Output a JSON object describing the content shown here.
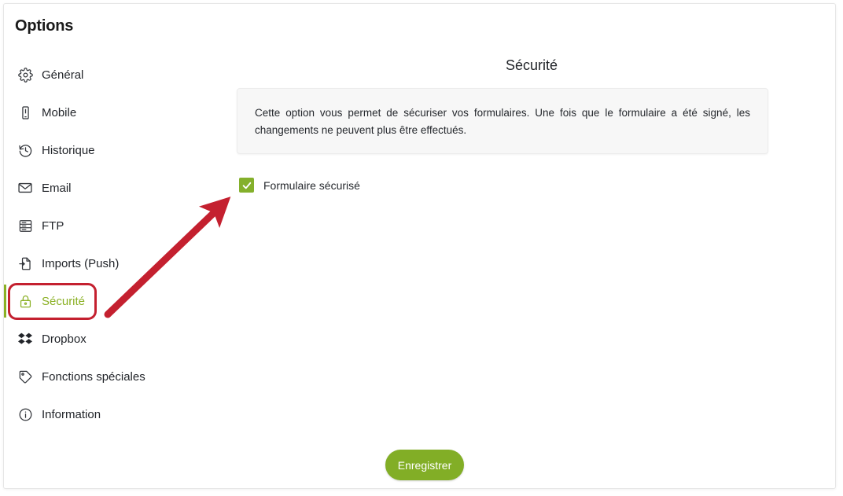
{
  "window": {
    "title": "Options"
  },
  "sidebar": {
    "items": [
      {
        "label": "Général",
        "icon": "gear-icon",
        "active": false
      },
      {
        "label": "Mobile",
        "icon": "mobile-icon",
        "active": false
      },
      {
        "label": "Historique",
        "icon": "history-icon",
        "active": false
      },
      {
        "label": "Email",
        "icon": "envelope-icon",
        "active": false
      },
      {
        "label": "FTP",
        "icon": "server-icon",
        "active": false
      },
      {
        "label": "Imports (Push)",
        "icon": "import-icon",
        "active": false
      },
      {
        "label": "Sécurité",
        "icon": "lock-icon",
        "active": true
      },
      {
        "label": "Dropbox",
        "icon": "dropbox-icon",
        "active": false
      },
      {
        "label": "Fonctions spéciales",
        "icon": "tag-icon",
        "active": false
      },
      {
        "label": "Information",
        "icon": "info-icon",
        "active": false
      }
    ],
    "active_color": "#8ab024"
  },
  "main": {
    "section_title": "Sécurité",
    "info_text": "Cette option vous permet de sécuriser vos formulaires. Une fois que le formulaire a été signé, les changements ne peuvent plus être effectués.",
    "checkbox": {
      "label": "Formulaire sécurisé",
      "checked": true,
      "color": "#84b02b"
    },
    "save_button": {
      "label": "Enregistrer",
      "color": "#82ae26"
    }
  },
  "annotations": {
    "highlight_color": "#c4202f",
    "arrow_color": "#c4202f",
    "target": "Sécurité"
  }
}
